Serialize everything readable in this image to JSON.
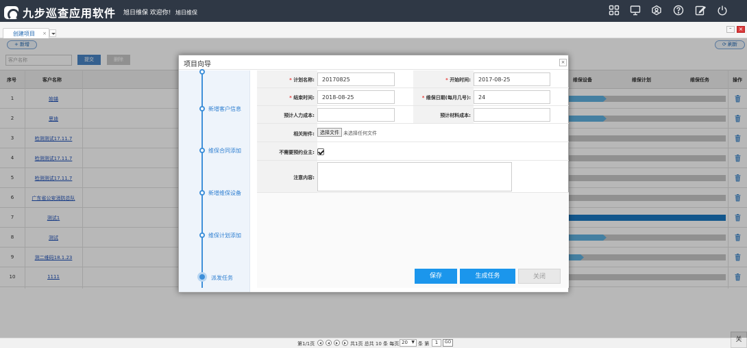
{
  "header": {
    "app_name": "九步巡查应用软件",
    "user_greeting": "旭日维保 欢迎你!",
    "org_link": "旭日维保",
    "icons": [
      "apps-grid-icon",
      "monitor-icon",
      "user-location-icon",
      "help-icon",
      "edit-icon",
      "power-icon"
    ]
  },
  "tabs": {
    "active_tab": "创建项目",
    "close_glyph": "×"
  },
  "window_controls": {
    "minimize_glyph": "–",
    "close_glyph": "×"
  },
  "toolbar": {
    "add_label": "+ 新增",
    "refresh_label": "⟳ 刷新",
    "search_placeholder": "客户名称",
    "submit_label": "提交",
    "delete_label": "删除"
  },
  "table": {
    "headers": {
      "no": "序号",
      "customer": "客户名称",
      "device": "维保设备",
      "plan": "维保计划",
      "task": "维保任务",
      "action": "操作"
    },
    "rows": [
      {
        "no": "1",
        "name": "始锚",
        "progress": 0.33
      },
      {
        "no": "2",
        "name": "思迪",
        "progress": 0.33
      },
      {
        "no": "3",
        "name": "检测测试17.11.7",
        "progress": 0
      },
      {
        "no": "4",
        "name": "检测测试17.11.7",
        "progress": 0
      },
      {
        "no": "5",
        "name": "检测测试17.11.7",
        "progress": 0
      },
      {
        "no": "6",
        "name": "广东省公安消防总队",
        "progress": 0
      },
      {
        "no": "7",
        "name": "测试1",
        "progress": 1.0
      },
      {
        "no": "8",
        "name": "测试",
        "progress": 0.33
      },
      {
        "no": "9",
        "name": "测二维码18.1.23",
        "progress": 0.2
      },
      {
        "no": "10",
        "name": "1111",
        "progress": 0
      }
    ]
  },
  "pager": {
    "page_info": "第1/1页",
    "total_info": "共1页 总共 10 条 每页",
    "page_size": "20",
    "page_label": "条 第",
    "page_input": "1",
    "go_label": "GO"
  },
  "corner_button": "关",
  "dialog": {
    "title": "项目向导",
    "close_glyph": "×",
    "steps": [
      "新增客户信息",
      "维保合同添加",
      "新增维保设备",
      "维保计划添加",
      "派发任务"
    ],
    "current_step": 5,
    "fields": {
      "plan_name_label": "计划名称:",
      "plan_name_value": "20170825",
      "start_time_label": "开始时间:",
      "start_time_value": "2017-08-25",
      "end_time_label": "结束时间:",
      "end_time_value": "2018-08-25",
      "maint_day_label": "维保日期(每月几号):",
      "maint_day_value": "24",
      "labor_cost_label": "预计人力成本:",
      "labor_cost_value": "",
      "material_cost_label": "预计材料成本:",
      "material_cost_value": "",
      "attachment_label": "相关附件:",
      "file_button": "选择文件",
      "file_status": "未选择任何文件",
      "no_appointment_label": "不需要预约业主:",
      "no_appointment_checked": true,
      "notes_label": "注意内容:",
      "notes_value": ""
    },
    "buttons": {
      "save": "保存",
      "generate": "生成任务",
      "close": "关闭"
    }
  },
  "colors": {
    "header_bg": "#2f3845",
    "progress_done": "#1a78c2",
    "progress_partial": "#5fb0e0",
    "progress_empty": "#c8c8c8",
    "primary_button": "#1b96ec",
    "step_accent": "#3d8fd9"
  }
}
